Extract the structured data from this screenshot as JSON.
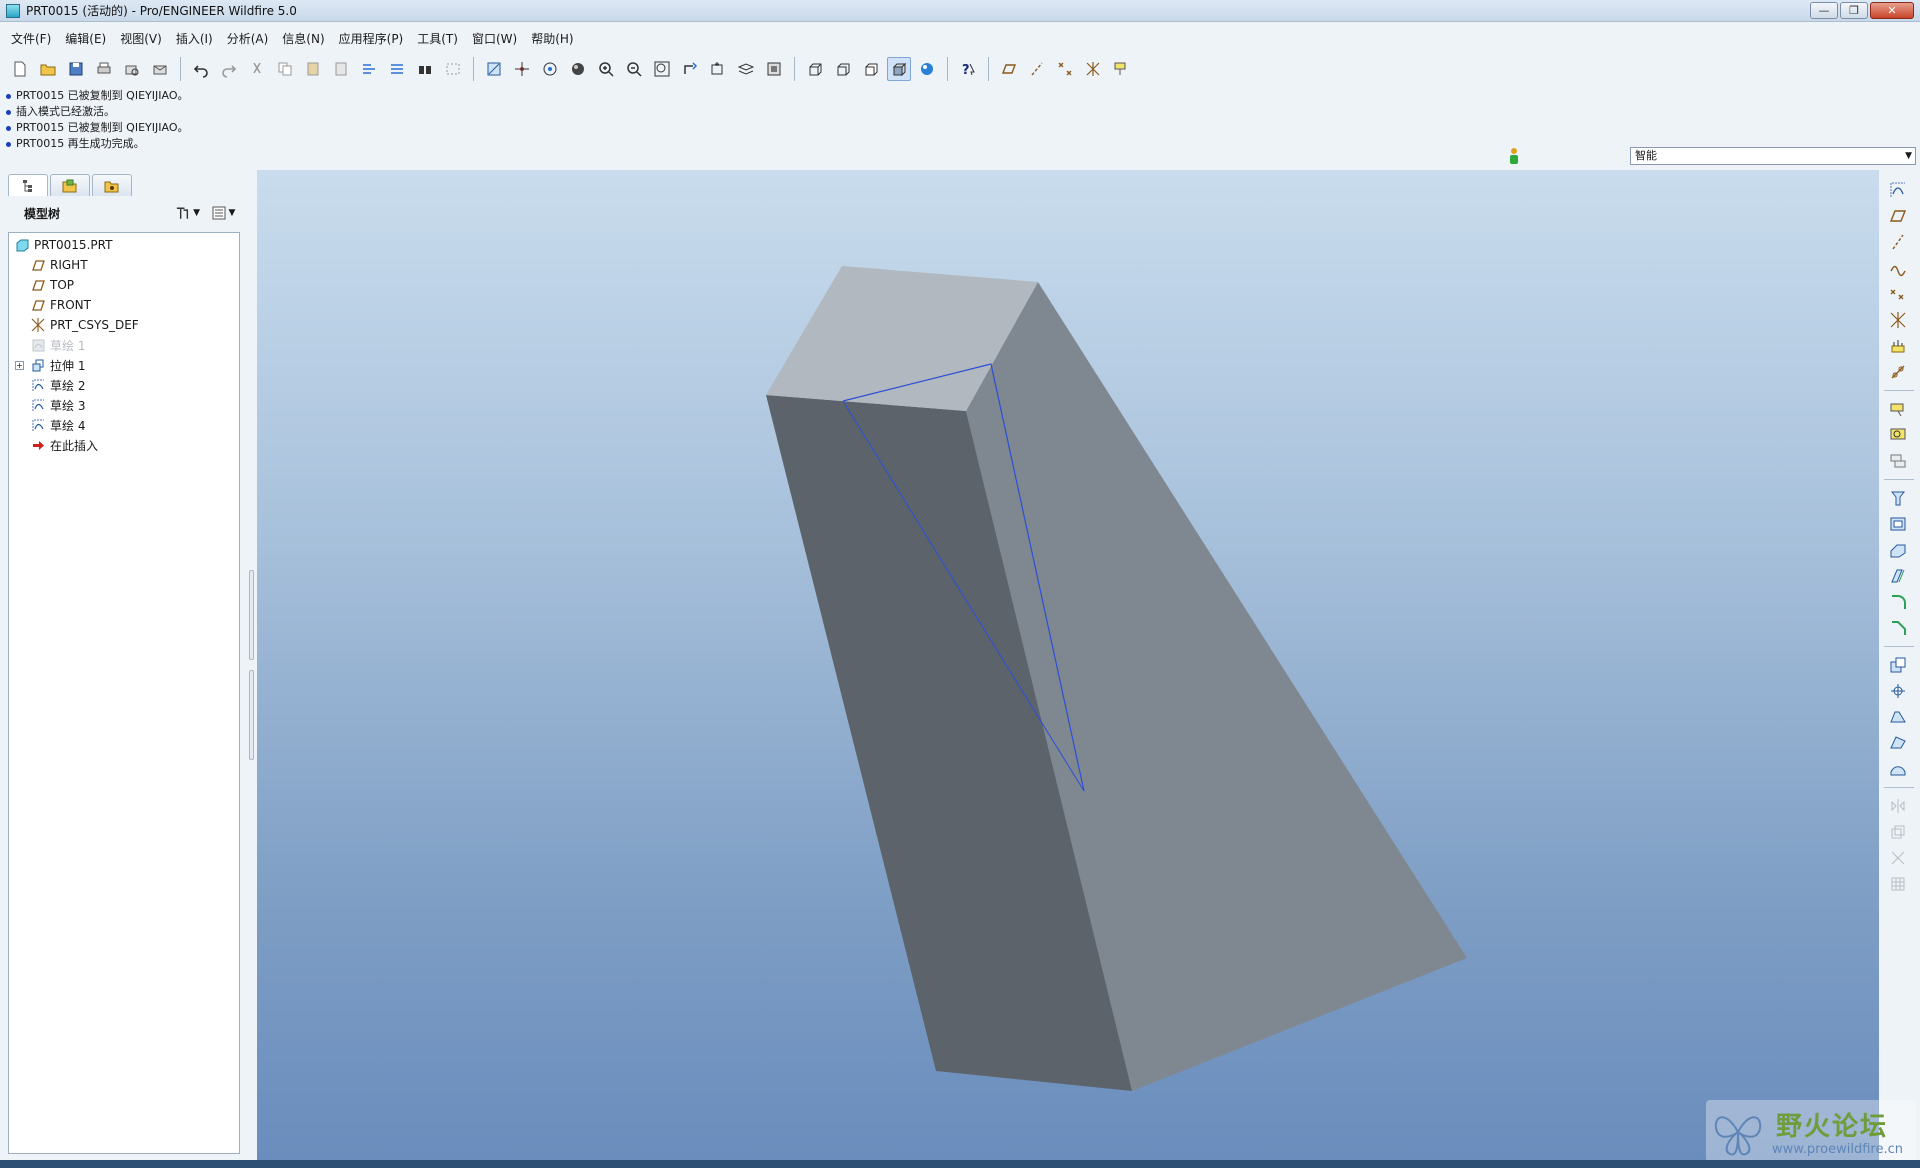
{
  "window": {
    "title": "PRT0015 (活动的) - Pro/ENGINEER Wildfire 5.0",
    "controls": {
      "minimize": "—",
      "maximize": "❐",
      "close": "✕"
    }
  },
  "menu": {
    "items": [
      "文件(F)",
      "编辑(E)",
      "视图(V)",
      "插入(I)",
      "分析(A)",
      "信息(N)",
      "应用程序(P)",
      "工具(T)",
      "窗口(W)",
      "帮助(H)"
    ]
  },
  "messages": [
    "PRT0015 已被复制到 QIEYIJIAO。",
    "插入模式已经激活。",
    "PRT0015 已被复制到 QIEYIJIAO。",
    "PRT0015 再生成功完成。"
  ],
  "filter": {
    "selected": "智能"
  },
  "model_tree": {
    "header": "模型树",
    "items": [
      {
        "label": "PRT0015.PRT",
        "icon": "part-icon"
      },
      {
        "label": "RIGHT",
        "icon": "datum-plane-icon"
      },
      {
        "label": "TOP",
        "icon": "datum-plane-icon"
      },
      {
        "label": "FRONT",
        "icon": "datum-plane-icon"
      },
      {
        "label": "PRT_CSYS_DEF",
        "icon": "csys-icon"
      },
      {
        "label": "草绘 1",
        "icon": "sketch-icon",
        "state": "suppressed"
      },
      {
        "label": "拉伸 1",
        "icon": "extrude-icon",
        "state": "expandable"
      },
      {
        "label": "草绘 2",
        "icon": "sketch-icon"
      },
      {
        "label": "草绘 3",
        "icon": "sketch-icon"
      },
      {
        "label": "草绘 4",
        "icon": "sketch-icon"
      },
      {
        "label": "在此插入",
        "icon": "insert-here-icon"
      }
    ]
  },
  "watermark": {
    "title": "野火论坛",
    "url": "www.proewildfire.cn"
  },
  "colors": {
    "viewport_top": "#c9dced",
    "viewport_bottom": "#6a8dbd",
    "model_top_face": "#b1b8bf",
    "model_left_face": "#5c636b",
    "model_right_face": "#7f8890",
    "sketch_edge": "#2b4fd8",
    "datum_plane": "#8a5a1e"
  }
}
